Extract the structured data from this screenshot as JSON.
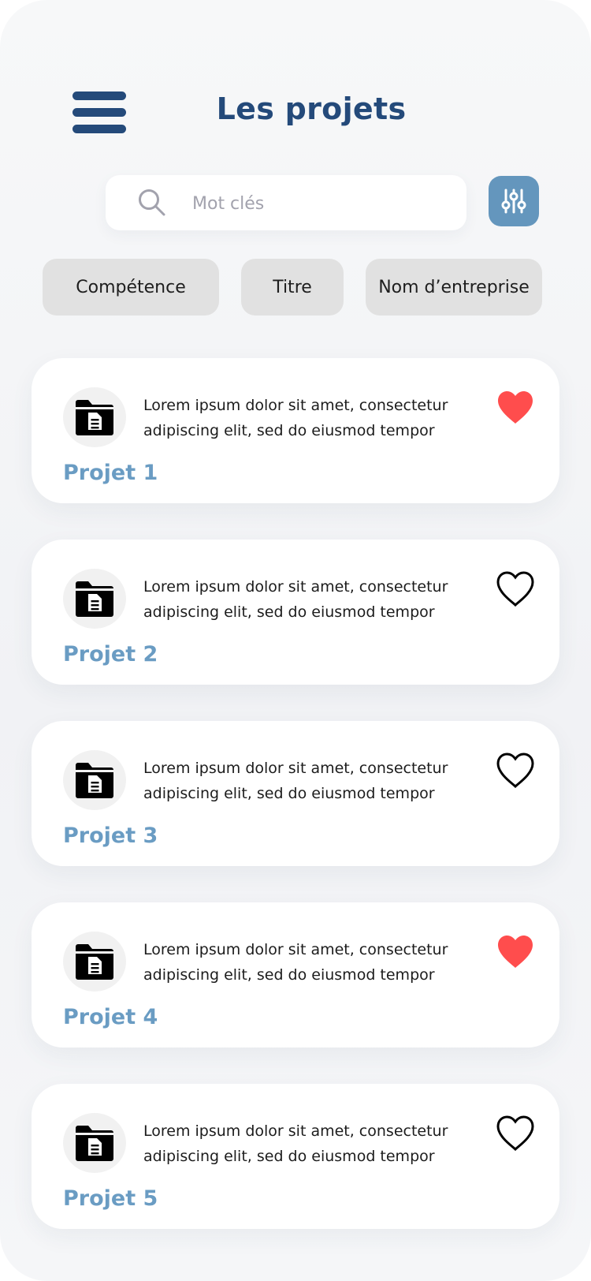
{
  "header": {
    "title": "Les projets",
    "menu_icon": "hamburger-menu-icon"
  },
  "search": {
    "placeholder": "Mot clés",
    "value": "",
    "icon": "search-icon"
  },
  "filter_button": {
    "icon": "sliders-icon",
    "color": "#6496bd"
  },
  "chips": [
    {
      "label": "Compétence"
    },
    {
      "label": "Titre"
    },
    {
      "label": "Nom d’entreprise"
    }
  ],
  "colors": {
    "title": "#244a7a",
    "project_title": "#6a9cc3",
    "heart_active": "#ff4d4d"
  },
  "projects": [
    {
      "title": "Projet 1",
      "description": "Lorem ipsum dolor sit amet, consectetur adipiscing elit, sed do eiusmod tempor",
      "favorite": true,
      "icon": "folder-document-icon"
    },
    {
      "title": "Projet 2",
      "description": "Lorem ipsum dolor sit amet, consectetur adipiscing elit, sed do eiusmod tempor",
      "favorite": false,
      "icon": "folder-document-icon"
    },
    {
      "title": "Projet 3",
      "description": "Lorem ipsum dolor sit amet, consectetur adipiscing elit, sed do eiusmod tempor",
      "favorite": false,
      "icon": "folder-document-icon"
    },
    {
      "title": "Projet 4",
      "description": "Lorem ipsum dolor sit amet, consectetur adipiscing elit, sed do eiusmod tempor",
      "favorite": true,
      "icon": "folder-document-icon"
    },
    {
      "title": "Projet 5",
      "description": "Lorem ipsum dolor sit amet, consectetur adipiscing elit, sed do eiusmod tempor",
      "favorite": false,
      "icon": "folder-document-icon"
    }
  ]
}
